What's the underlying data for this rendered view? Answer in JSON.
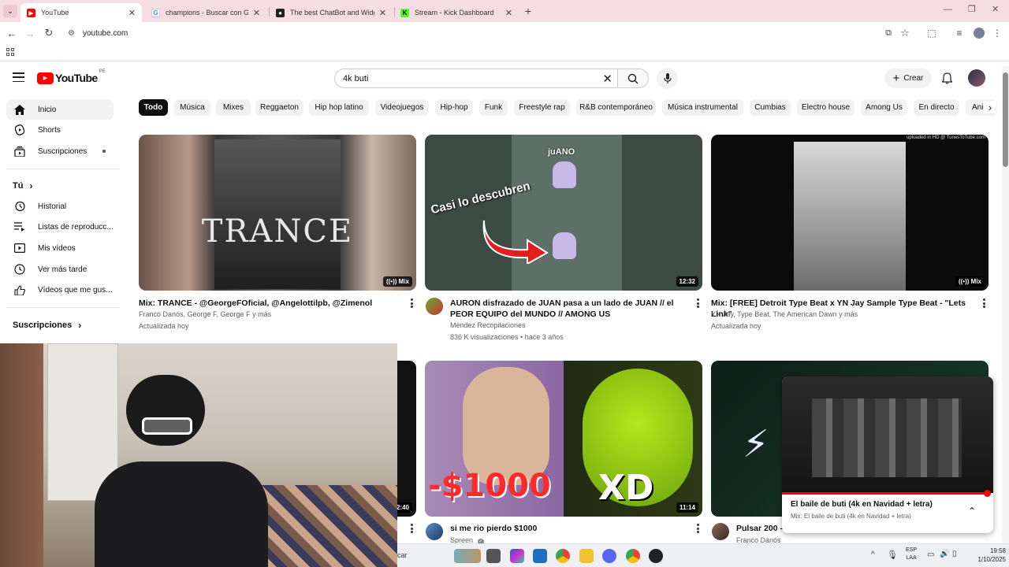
{
  "browser": {
    "tabs": [
      {
        "label": "YouTube",
        "active": true
      },
      {
        "label": "champions - Buscar con Google",
        "active": false
      },
      {
        "label": "The best ChatBot and Widgets",
        "active": false
      },
      {
        "label": "Stream - Kick Dashboard",
        "active": false
      }
    ],
    "url": "youtube.com",
    "new_tab_symbol": "+"
  },
  "youtube": {
    "logo_text": "YouTube",
    "country_code": "PE",
    "search_value": "4k buti",
    "create_label": "Crear",
    "chips": [
      "Todo",
      "Música",
      "Mixes",
      "Reggaeton",
      "Hip hop latino",
      "Videojuegos",
      "Hip-hop",
      "Funk",
      "Freestyle rap",
      "R&B contemporáneo",
      "Música instrumental",
      "Cumbias",
      "Electro house",
      "Among Us",
      "En directo",
      "Anim"
    ]
  },
  "sidebar": {
    "items": [
      {
        "label": "Inicio",
        "icon": "home-icon"
      },
      {
        "label": "Shorts",
        "icon": "shorts-icon"
      },
      {
        "label": "Suscripciones",
        "icon": "subscriptions-icon"
      }
    ],
    "you_header": "Tú",
    "you_items": [
      {
        "label": "Historial",
        "icon": "history-icon"
      },
      {
        "label": "Listas de reproducc...",
        "icon": "playlists-icon"
      },
      {
        "label": "Mis vídeos",
        "icon": "my-videos-icon"
      },
      {
        "label": "Ver más tarde",
        "icon": "watch-later-icon"
      },
      {
        "label": "Vídeos que me gus...",
        "icon": "liked-icon"
      }
    ],
    "subs_header": "Suscripciones"
  },
  "videos": [
    {
      "title": "Mix: TRANCE - @GeorgeFOficial, @Angelottilpb, @Zimenol",
      "line2": "Franco Danós, George F, George F y más",
      "line3": "Actualizada hoy",
      "badge": "Mix",
      "thumb_text": "TRANCE"
    },
    {
      "title": "AURON disfrazado de JUAN pasa a un lado de JUAN // el PEOR EQUIPO del MUNDO // AMONG US",
      "line2": "Méndez Recopilaciones",
      "line3": "836 K visualizaciones • hace 3 años",
      "badge": "12:32",
      "thumb_text": "Casi lo descubren",
      "thumb_label": "juANO"
    },
    {
      "title": "Mix: [FREE] Detroit Type Beat x YN Jay Sample Type Beat - \"Lets Link\"",
      "line2": "YN Jay, Type Beat, The American Dawn y más",
      "line3": "Actualizada hoy",
      "badge": "Mix",
      "thumb_text": "uploaded in HD @ TunesToTube.com"
    },
    {
      "title": "",
      "badge": "2:40"
    },
    {
      "title": "si me rio pierdo $1000",
      "line2": "Spreen",
      "badge": "11:14",
      "thumb_text": "-$1000",
      "thumb_text2": "XD"
    },
    {
      "title": "Pulsar 200 -",
      "line2": "Franco Danós",
      "badge": ""
    }
  ],
  "miniplayer": {
    "title": "El baile de buti (4k en Navidad + letra)",
    "subtitle": "Mix: El baile de buti (4k en Navidad + letra)"
  },
  "taskbar": {
    "search_partial": "car",
    "lang_top": "ESP",
    "lang_bottom": "LAA",
    "time": "19:58",
    "date": "1/10/2025"
  },
  "colors": {
    "tab_strip": "#f6dde3",
    "yt_red": "#ff0000",
    "chip_active": "#0f0f0f"
  }
}
